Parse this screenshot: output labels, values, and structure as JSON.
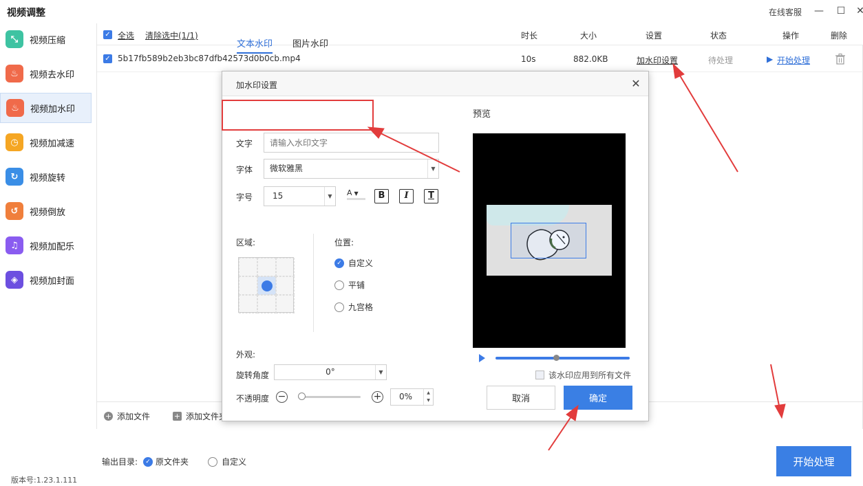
{
  "window": {
    "title": "视频调整",
    "online_service": "在线客服",
    "minimize_glyph": "—",
    "maximize_glyph": "☐",
    "close_glyph": "✕"
  },
  "sidebar": {
    "items": [
      {
        "label": "视频压缩",
        "icon": "compress-icon",
        "color": "#3ec3a2",
        "glyph": "⤡"
      },
      {
        "label": "视频去水印",
        "icon": "remove-watermark-icon",
        "color": "#f06a4a",
        "glyph": "♨"
      },
      {
        "label": "视频加水印",
        "icon": "add-watermark-icon",
        "color": "#f06a4a",
        "glyph": "♨"
      },
      {
        "label": "视频加减速",
        "icon": "speed-icon",
        "color": "#f5a623",
        "glyph": "◷"
      },
      {
        "label": "视频旋转",
        "icon": "rotate-icon",
        "color": "#3a8ee6",
        "glyph": "↻"
      },
      {
        "label": "视频倒放",
        "icon": "reverse-icon",
        "color": "#f07f3c",
        "glyph": "↺"
      },
      {
        "label": "视频加配乐",
        "icon": "music-icon",
        "color": "#8a5cf0",
        "glyph": "♫"
      },
      {
        "label": "视频加封面",
        "icon": "cover-icon",
        "color": "#6c4fe0",
        "glyph": "◈"
      }
    ],
    "version": "版本号:1.23.1.111"
  },
  "table": {
    "select_all": "全选",
    "clear_selected": "清除选中(1/1)",
    "columns": {
      "duration": "时长",
      "size": "大小",
      "settings": "设置",
      "status": "状态",
      "action": "操作",
      "delete": "删除"
    },
    "rows": [
      {
        "filename": "5b17fb589b2eb3bc87dfb42573d0b0cb.mp4",
        "duration": "10s",
        "size": "882.0KB",
        "settings": "加水印设置",
        "status": "待处理",
        "action": "开始处理"
      }
    ]
  },
  "toolbar": {
    "add_file": "添加文件",
    "add_folder": "添加文件夹"
  },
  "output": {
    "label": "输出目录:",
    "option_original": "原文件夹",
    "option_custom": "自定义"
  },
  "start_button": "开始处理",
  "dialog": {
    "title": "加水印设置",
    "tabs": [
      "文本水印",
      "图片水印"
    ],
    "text_label": "文字",
    "text_placeholder": "请输入水印文字",
    "font_label": "字体",
    "font_value": "微软雅黑",
    "size_label": "字号",
    "size_value": "15",
    "color_glyph": "A",
    "bold_glyph": "B",
    "italic_glyph": "I",
    "text_glyph": "T",
    "region_label": "区域:",
    "position_label": "位置:",
    "position_options": [
      "自定义",
      "平铺",
      "九宫格"
    ],
    "position_selected": 0,
    "appearance_label": "外观:",
    "rotation_label": "旋转角度",
    "rotation_value": "0°",
    "opacity_label": "不透明度",
    "opacity_value": "0%",
    "opacity_fraction": 0,
    "preview_label": "预览",
    "apply_all": "该水印应用到所有文件",
    "cancel": "取消",
    "ok": "确定"
  },
  "colors": {
    "accent": "#3a7fe4",
    "annotation_red": "#e23c3c"
  }
}
